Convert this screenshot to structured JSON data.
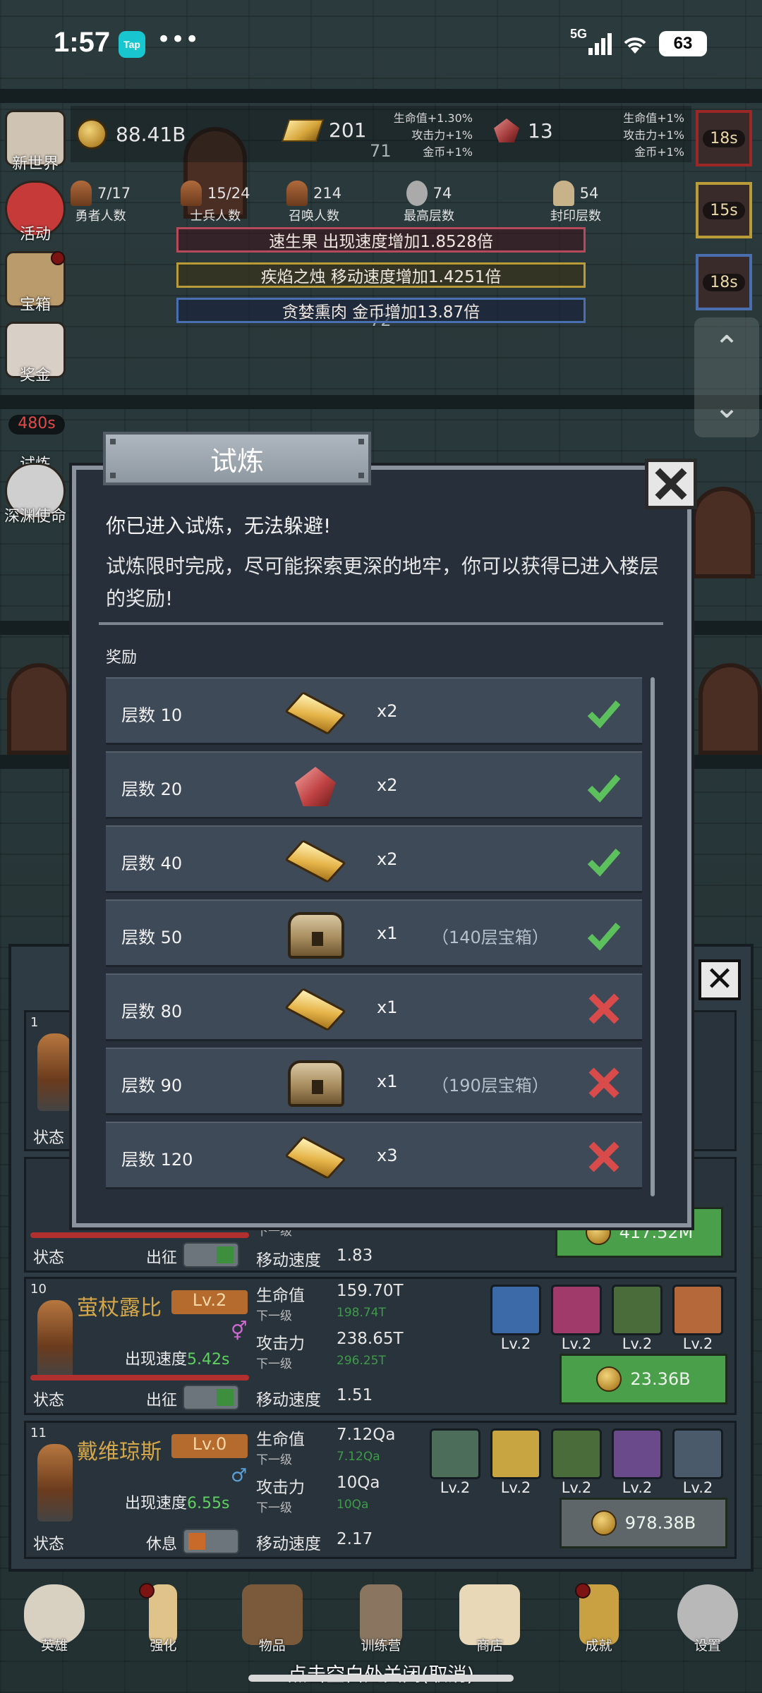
{
  "status_bar": {
    "time": "1:57",
    "tap": "Tap",
    "dots": "•••",
    "network": "5G",
    "battery": "63"
  },
  "resources": {
    "coins": "88.41B",
    "gold_bars": "201",
    "gems": "13",
    "ghost_number_top": "71",
    "ghost_number_mid": "72",
    "bonus_left": [
      "生命值+1.30%",
      "攻击力+1%",
      "金币+1%"
    ],
    "bonus_right": [
      "生命值+1%",
      "攻击力+1%",
      "金币+1%"
    ]
  },
  "counters": [
    {
      "value": "7/17",
      "label": "勇者人数"
    },
    {
      "value": "15/24",
      "label": "士兵人数"
    },
    {
      "value": "214",
      "label": "召唤人数"
    },
    {
      "value": "74",
      "label": "最高层数"
    },
    {
      "value": "54",
      "label": "封印层数"
    }
  ],
  "buffs": {
    "red": "速生果 出现速度增加1.8528倍",
    "yellow": "疾焰之烛 移动速度增加1.4251倍",
    "blue": "贪婪熏肉 金币增加13.87倍"
  },
  "left_menu": [
    {
      "label": "新世界"
    },
    {
      "label": "活动"
    },
    {
      "label": "宝箱"
    },
    {
      "label": "奖金"
    },
    {
      "label": "试炼"
    },
    {
      "label": "深渊使命"
    }
  ],
  "trial_timer": "480s",
  "right_timers": [
    "18s",
    "15s",
    "18s"
  ],
  "scroll_arrows": {
    "up": "⌃",
    "down": "⌄"
  },
  "dialog": {
    "title": "试炼",
    "close": "✕",
    "line1": "你已进入试炼，无法躲避!",
    "line2": "试炼限时完成，尽可能探索更深的地牢，你可以获得已进入楼层的奖励!",
    "reward_label": "奖励",
    "rewards": [
      {
        "floor": "层数 10",
        "item": "gold-bar",
        "qty": "x2",
        "note": "",
        "done": true
      },
      {
        "floor": "层数 20",
        "item": "ruby",
        "qty": "x2",
        "note": "",
        "done": true
      },
      {
        "floor": "层数 40",
        "item": "gold-bar",
        "qty": "x2",
        "note": "",
        "done": true
      },
      {
        "floor": "层数 50",
        "item": "chest",
        "qty": "x1",
        "note": "（140层宝箱）",
        "done": true
      },
      {
        "floor": "层数 80",
        "item": "gold-bar",
        "qty": "x1",
        "note": "",
        "done": false
      },
      {
        "floor": "层数 90",
        "item": "chest",
        "qty": "x1",
        "note": "（190层宝箱）",
        "done": false
      },
      {
        "floor": "层数 120",
        "item": "gold-bar",
        "qty": "x3",
        "note": "",
        "done": false
      }
    ]
  },
  "hero_panel": {
    "close": "✕",
    "card_top": {
      "index": "1",
      "status": "状态"
    },
    "partial_card": {
      "status": "状态",
      "action": "出征",
      "speed_label": "移动速度",
      "speed": "1.83",
      "next_label": "下一级",
      "cost": "417.52M"
    },
    "cards": [
      {
        "index": "10",
        "name": "萤杖露比",
        "level": "Lv.2",
        "gender": "⚥",
        "appear_label": "出现速度",
        "appear": "5.42s",
        "hp_label": "生命值",
        "hp": "159.70T",
        "next_label": "下一级",
        "hp_next": "198.74T",
        "atk_label": "攻击力",
        "atk": "238.65T",
        "atk_next": "296.25T",
        "speed_label": "移动速度",
        "speed": "1.51",
        "status": "状态",
        "action": "出征",
        "skills": [
          "Lv.2",
          "Lv.2",
          "Lv.2",
          "Lv.2"
        ],
        "cost": "23.36B"
      },
      {
        "index": "11",
        "name": "戴维琼斯",
        "level": "Lv.0",
        "gender": "♂",
        "appear_label": "出现速度",
        "appear": "6.55s",
        "hp_label": "生命值",
        "hp": "7.12Qa",
        "next_label": "下一级",
        "hp_next": "7.12Qa",
        "atk_label": "攻击力",
        "atk": "10Qa",
        "atk_next": "10Qa",
        "speed_label": "移动速度",
        "speed": "2.17",
        "status": "状态",
        "action": "休息",
        "skills": [
          "Lv.2",
          "Lv.2",
          "Lv.2",
          "Lv.2",
          "Lv.2"
        ],
        "cost": "978.38B"
      }
    ]
  },
  "bottom_nav": [
    {
      "label": "英雄"
    },
    {
      "label": "强化"
    },
    {
      "label": "物品"
    },
    {
      "label": "训练营"
    },
    {
      "label": "商店"
    },
    {
      "label": "成就"
    },
    {
      "label": "设置"
    }
  ],
  "hint": "点击空白处关闭(取消)",
  "colors": {
    "done": "#5cc15c",
    "not_done": "#d94a4a",
    "dialog_bg": "#262f3a",
    "row_bg": "#3f4a58",
    "green_value": "#5fd05f",
    "hero_name": "#d4a64a"
  }
}
